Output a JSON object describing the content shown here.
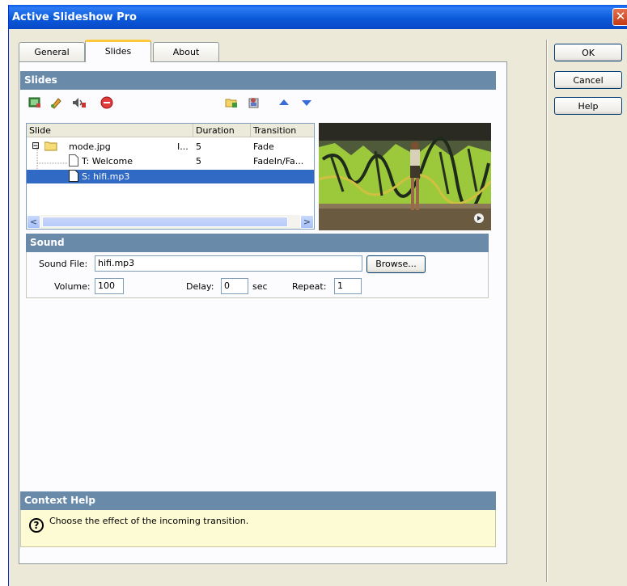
{
  "window": {
    "title": "Active Slideshow Pro",
    "close_glyph": "✕"
  },
  "tabs": [
    {
      "label": "General",
      "active": false
    },
    {
      "label": "Slides",
      "active": true
    },
    {
      "label": "About",
      "active": false
    }
  ],
  "dialog_buttons": {
    "ok": "OK",
    "cancel": "Cancel",
    "help": "Help"
  },
  "slides_section": {
    "title": "Slides",
    "toolbar": {
      "left": [
        "add-image-icon",
        "add-text-icon",
        "add-sound-icon",
        "delete-icon"
      ],
      "right": [
        "new-folder-icon",
        "properties-icon",
        "move-up-icon",
        "move-down-icon"
      ]
    },
    "columns": [
      "Slide",
      "Duration",
      "Transition"
    ],
    "rows": [
      {
        "expander": "⊟",
        "icon": "folder-icon",
        "name": "mode.jpg",
        "extra": "I...",
        "duration": "5",
        "transition": "Fade",
        "selected": false
      },
      {
        "icon": "page-icon",
        "name": "T: Welcome",
        "extra": "",
        "duration": "5",
        "transition": "FadeIn/Fa...",
        "selected": false
      },
      {
        "icon": "page-icon",
        "name": "S: hifi.mp3",
        "extra": "",
        "duration": "",
        "transition": "",
        "selected": true
      }
    ],
    "scroll_left": "<",
    "scroll_right": ">"
  },
  "sound_section": {
    "title": "Sound",
    "sound_file_label": "Sound File:",
    "sound_file_value": "hifi.mp3",
    "browse_label": "Browse...",
    "volume_label": "Volume:",
    "volume_value": "100",
    "delay_label": "Delay:",
    "delay_value": "0",
    "delay_unit": "sec",
    "repeat_label": "Repeat:",
    "repeat_value": "1"
  },
  "context_help": {
    "title": "Context Help",
    "icon": "?",
    "text": "Choose the effect of the incoming transition."
  },
  "colors": {
    "title_bar": "#0a5ae6",
    "section_header": "#6a8aaa",
    "selection": "#316ac5",
    "help_background": "#fdfbd4"
  }
}
